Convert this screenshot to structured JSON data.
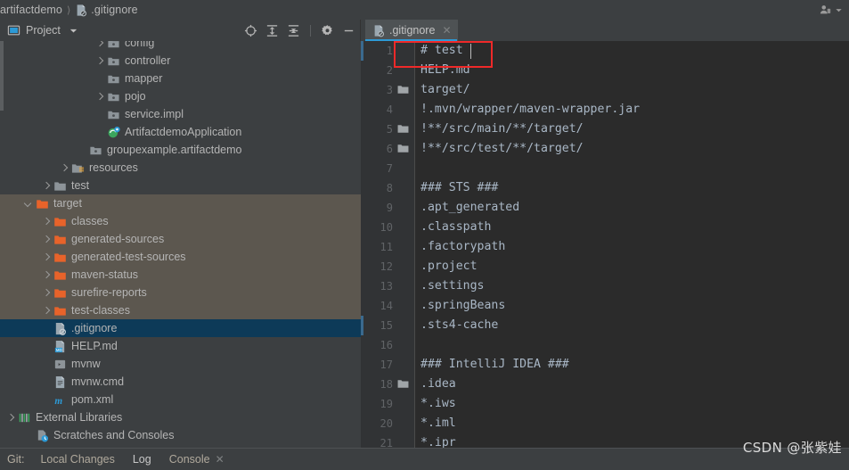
{
  "window": {
    "breadcrumb": [
      {
        "label": "artifactdemo",
        "icon": "module-icon"
      },
      {
        "label": ".gitignore",
        "icon": "gitignore-file-icon"
      }
    ],
    "account_icon": "user-account-icon",
    "account_dropdown_icon": "chevron-down-icon"
  },
  "project_panel": {
    "title": "Project",
    "dropdown_icon": "chevron-down-icon",
    "view_icon": "project-view-icon",
    "tools": [
      {
        "name": "scroll-from-source-icon",
        "glyph": "locate"
      },
      {
        "name": "expand-all-icon",
        "glyph": "expand"
      },
      {
        "name": "collapse-all-icon",
        "glyph": "collapse"
      },
      {
        "name": "settings-gear-icon",
        "glyph": "gear"
      },
      {
        "name": "hide-panel-icon",
        "glyph": "minus"
      }
    ],
    "tree": [
      {
        "label": "config",
        "indent": 5,
        "arrow": "right",
        "icon": "package-folder-icon",
        "state": "normal",
        "clipped": true
      },
      {
        "label": "controller",
        "indent": 5,
        "arrow": "right",
        "icon": "package-folder-icon",
        "state": "normal"
      },
      {
        "label": "mapper",
        "indent": 5,
        "arrow": "none",
        "icon": "package-folder-icon",
        "state": "normal"
      },
      {
        "label": "pojo",
        "indent": 5,
        "arrow": "right",
        "icon": "package-folder-icon",
        "state": "normal"
      },
      {
        "label": "service.impl",
        "indent": 5,
        "arrow": "none",
        "icon": "package-folder-icon",
        "state": "normal"
      },
      {
        "label": "ArtifactdemoApplication",
        "indent": 5,
        "arrow": "none",
        "icon": "spring-boot-class-icon",
        "state": "normal"
      },
      {
        "label": "groupexample.artifactdemo",
        "indent": 4,
        "arrow": "none",
        "icon": "package-folder-icon",
        "state": "normal"
      },
      {
        "label": "resources",
        "indent": 3,
        "arrow": "right",
        "icon": "resources-folder-icon",
        "state": "normal"
      },
      {
        "label": "test",
        "indent": 2,
        "arrow": "right",
        "icon": "test-folder-icon",
        "state": "normal"
      },
      {
        "label": "target",
        "indent": 1,
        "arrow": "down",
        "icon": "excluded-folder-icon",
        "state": "excluded"
      },
      {
        "label": "classes",
        "indent": 2,
        "arrow": "right",
        "icon": "excluded-folder-icon",
        "state": "excluded"
      },
      {
        "label": "generated-sources",
        "indent": 2,
        "arrow": "right",
        "icon": "excluded-folder-icon",
        "state": "excluded"
      },
      {
        "label": "generated-test-sources",
        "indent": 2,
        "arrow": "right",
        "icon": "excluded-folder-icon",
        "state": "excluded"
      },
      {
        "label": "maven-status",
        "indent": 2,
        "arrow": "right",
        "icon": "excluded-folder-icon",
        "state": "excluded"
      },
      {
        "label": "surefire-reports",
        "indent": 2,
        "arrow": "right",
        "icon": "excluded-folder-icon",
        "state": "excluded"
      },
      {
        "label": "test-classes",
        "indent": 2,
        "arrow": "right",
        "icon": "excluded-folder-icon",
        "state": "excluded"
      },
      {
        "label": ".gitignore",
        "indent": 2,
        "arrow": "none",
        "icon": "gitignore-file-icon",
        "state": "selected"
      },
      {
        "label": "HELP.md",
        "indent": 2,
        "arrow": "none",
        "icon": "markdown-file-icon",
        "state": "normal"
      },
      {
        "label": "mvnw",
        "indent": 2,
        "arrow": "none",
        "icon": "shell-script-icon",
        "state": "normal"
      },
      {
        "label": "mvnw.cmd",
        "indent": 2,
        "arrow": "none",
        "icon": "cmd-script-icon",
        "state": "normal"
      },
      {
        "label": "pom.xml",
        "indent": 2,
        "arrow": "none",
        "icon": "maven-pom-icon",
        "state": "normal"
      },
      {
        "label": "External Libraries",
        "indent": 0,
        "arrow": "right",
        "icon": "libraries-icon",
        "state": "normal"
      },
      {
        "label": "Scratches and Consoles",
        "indent": 1,
        "arrow": "none",
        "icon": "scratches-icon",
        "state": "normal"
      }
    ]
  },
  "editor": {
    "tab": {
      "label": ".gitignore",
      "icon": "gitignore-file-icon",
      "close_icon": "close-icon",
      "active": true
    },
    "caret_line": 1,
    "caret_column": 7,
    "lines": [
      {
        "n": 1,
        "text": "# test",
        "kind": "comment",
        "fold": false
      },
      {
        "n": 2,
        "text": "HELP.md",
        "kind": "plain",
        "fold": false
      },
      {
        "n": 3,
        "text": "target/",
        "kind": "plain",
        "fold": true
      },
      {
        "n": 4,
        "text": "!.mvn/wrapper/maven-wrapper.jar",
        "kind": "negate",
        "fold": false
      },
      {
        "n": 5,
        "text": "!**/src/main/**/target/",
        "kind": "negate",
        "fold": true
      },
      {
        "n": 6,
        "text": "!**/src/test/**/target/",
        "kind": "negate",
        "fold": true
      },
      {
        "n": 7,
        "text": "",
        "kind": "plain",
        "fold": false
      },
      {
        "n": 8,
        "text": "### STS ###",
        "kind": "comment",
        "fold": false
      },
      {
        "n": 9,
        "text": ".apt_generated",
        "kind": "plain",
        "fold": false
      },
      {
        "n": 10,
        "text": ".classpath",
        "kind": "plain",
        "fold": false
      },
      {
        "n": 11,
        "text": ".factorypath",
        "kind": "plain",
        "fold": false
      },
      {
        "n": 12,
        "text": ".project",
        "kind": "plain",
        "fold": false
      },
      {
        "n": 13,
        "text": ".settings",
        "kind": "plain",
        "fold": false
      },
      {
        "n": 14,
        "text": ".springBeans",
        "kind": "plain",
        "fold": false
      },
      {
        "n": 15,
        "text": ".sts4-cache",
        "kind": "plain",
        "fold": false
      },
      {
        "n": 16,
        "text": "",
        "kind": "plain",
        "fold": false
      },
      {
        "n": 17,
        "text": "### IntelliJ IDEA ###",
        "kind": "comment",
        "fold": false
      },
      {
        "n": 18,
        "text": ".idea",
        "kind": "plain",
        "fold": true
      },
      {
        "n": 19,
        "text": "*.iws",
        "kind": "plain",
        "fold": false
      },
      {
        "n": 20,
        "text": "*.iml",
        "kind": "plain",
        "fold": false
      },
      {
        "n": 21,
        "text": "*.ipr",
        "kind": "plain",
        "fold": false
      }
    ]
  },
  "annotation": {
    "shape": "rectangle",
    "color": "#ef2929",
    "target": "editor line 1 '# test'"
  },
  "statusbar": {
    "git_label": "Git:",
    "tabs": [
      {
        "label": "Local Changes",
        "active": false,
        "closable": false
      },
      {
        "label": "Log",
        "active": true,
        "closable": false
      },
      {
        "label": "Console",
        "active": false,
        "closable": true
      }
    ],
    "close_icon": "close-icon"
  },
  "watermark": {
    "text": "CSDN @张紫娃"
  },
  "colors": {
    "chrome": "#3c3f41",
    "editor_bg": "#2b2b2b",
    "gutter_bg": "#313335",
    "selection": "#0d3a58",
    "excluded": "#5c574f",
    "accent_blue": "#2d9ad6",
    "annotation_red": "#ef2929",
    "code_text": "#a9b7c6",
    "comment_text": "#808080",
    "negate_text": "#cc7832",
    "folder_orange": "#e8632a",
    "folder_grey": "#9aa0a6"
  }
}
